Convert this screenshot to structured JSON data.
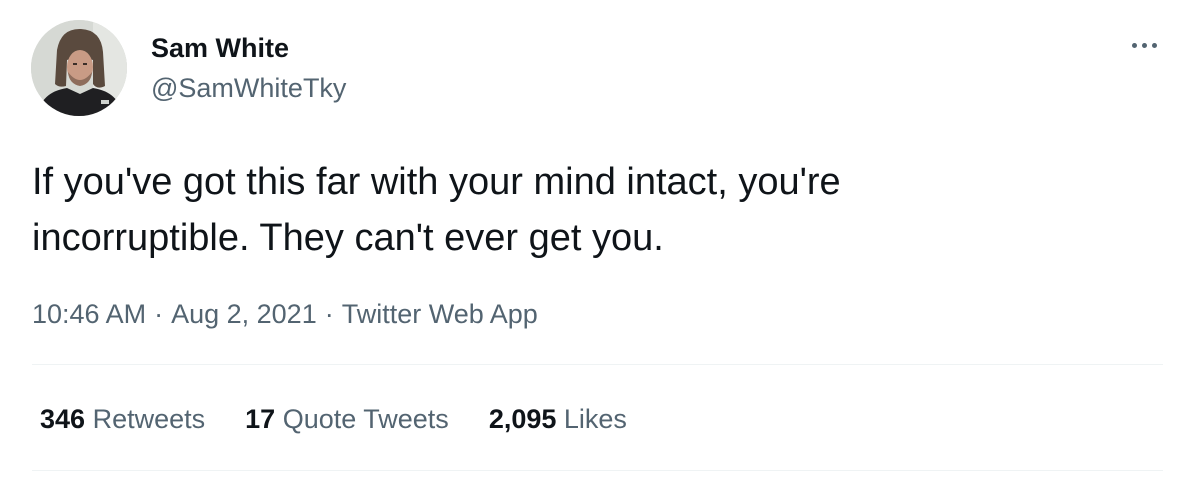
{
  "author": {
    "name": "Sam White",
    "handle": "@SamWhiteTky"
  },
  "tweet": {
    "lines": [
      "If you've got this far with your mind intact, you're",
      "incorruptible. They can't ever get you."
    ],
    "time": "10:46 AM",
    "date": "Aug 2, 2021",
    "source": "Twitter Web App",
    "separator": "·"
  },
  "stats": {
    "retweets": {
      "count": "346",
      "label": "Retweets"
    },
    "quotes": {
      "count": "17",
      "label": "Quote Tweets"
    },
    "likes": {
      "count": "2,095",
      "label": "Likes"
    }
  },
  "icons": {
    "more": "more-options-icon"
  },
  "colors": {
    "text": "#0f1419",
    "secondary": "#536471",
    "divider": "#eff3f4"
  }
}
